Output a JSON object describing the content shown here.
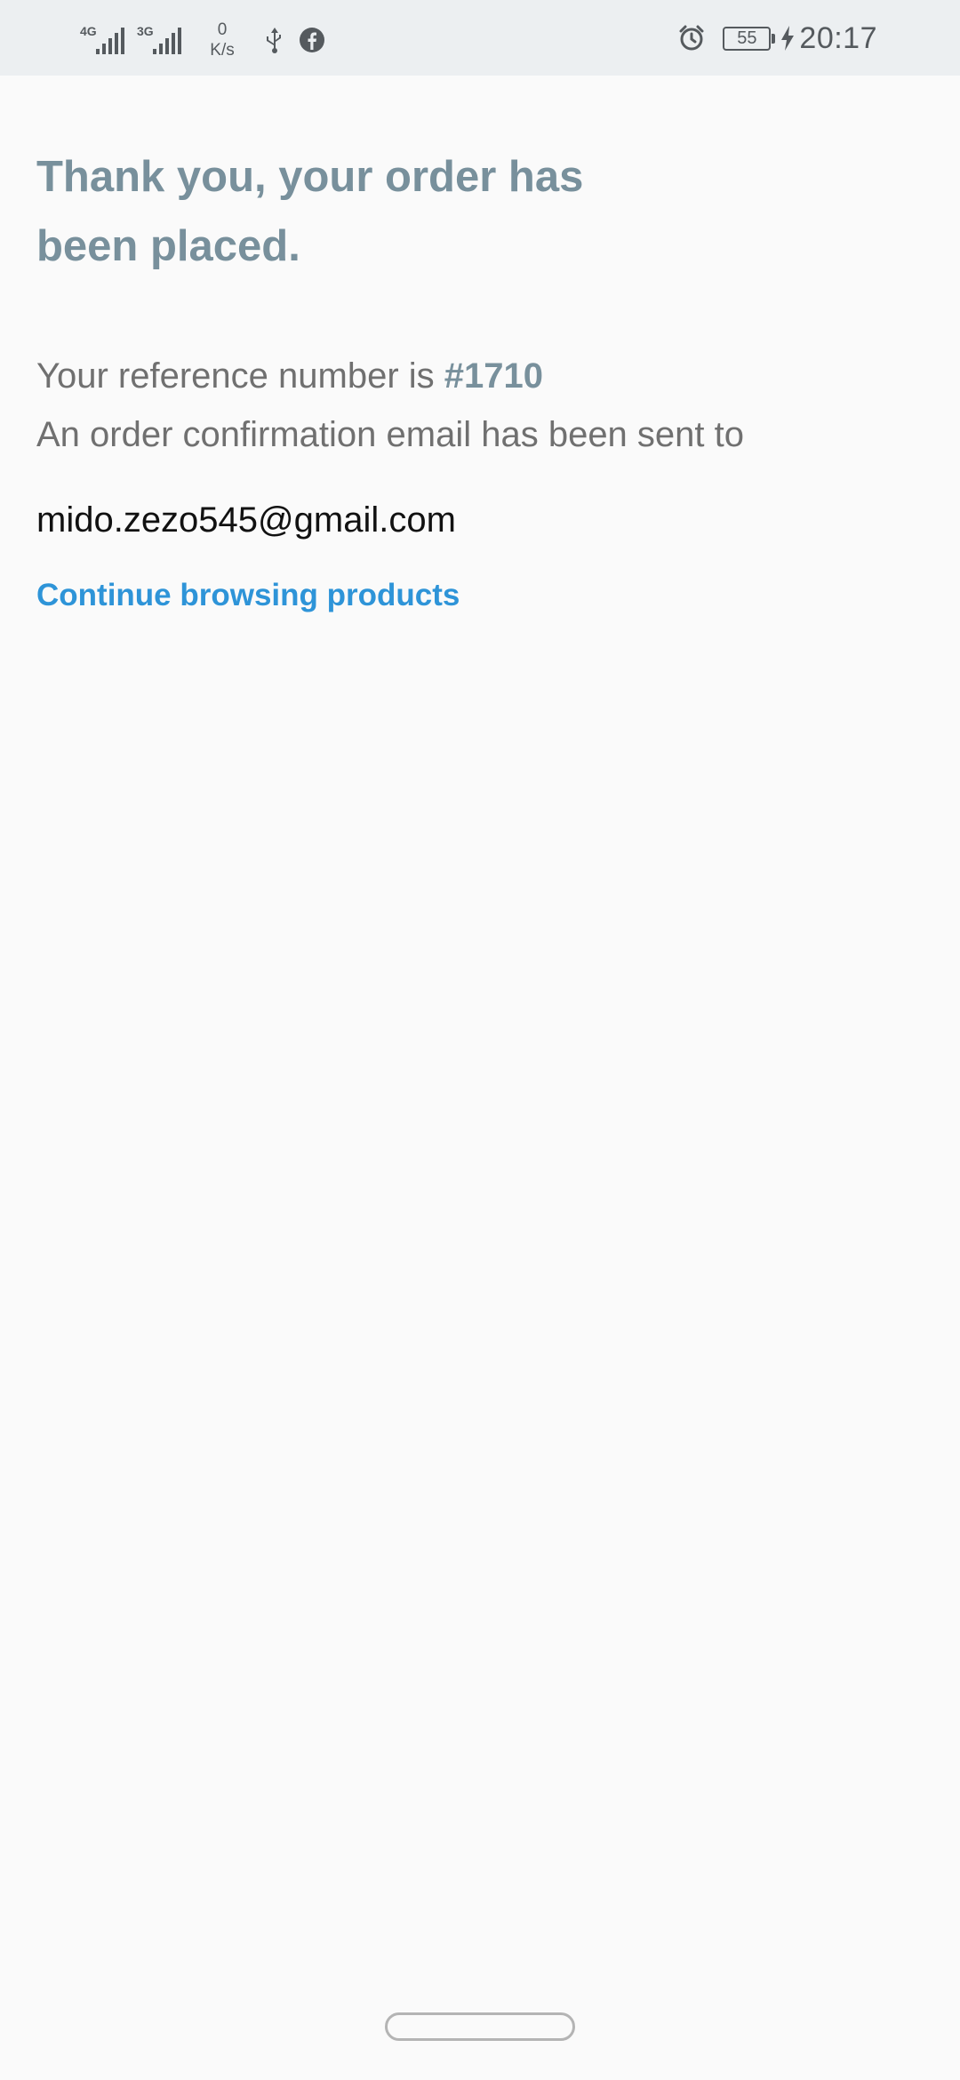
{
  "status_bar": {
    "network_1": "4G",
    "network_2": "3G",
    "speed_value": "0",
    "speed_unit": "K/s",
    "battery_level": "55",
    "time": "20:17",
    "icons": [
      "signal-4g-icon",
      "signal-3g-icon",
      "usb-icon",
      "facebook-icon",
      "alarm-icon",
      "battery-icon",
      "charging-bolt-icon"
    ]
  },
  "confirmation": {
    "title": "Thank you, your order has been placed.",
    "reference_prefix": "Your reference number is",
    "reference_number": "#1710",
    "email_note": "An order confirmation email has been sent to",
    "email": "mido.zezo545@gmail.com",
    "continue_label": "Continue browsing products"
  },
  "colors": {
    "title": "#78909c",
    "body_text": "#707070",
    "email_text": "#111111",
    "link": "#2e94d8",
    "background": "#fafafa",
    "status_bar": "#eceff1"
  }
}
